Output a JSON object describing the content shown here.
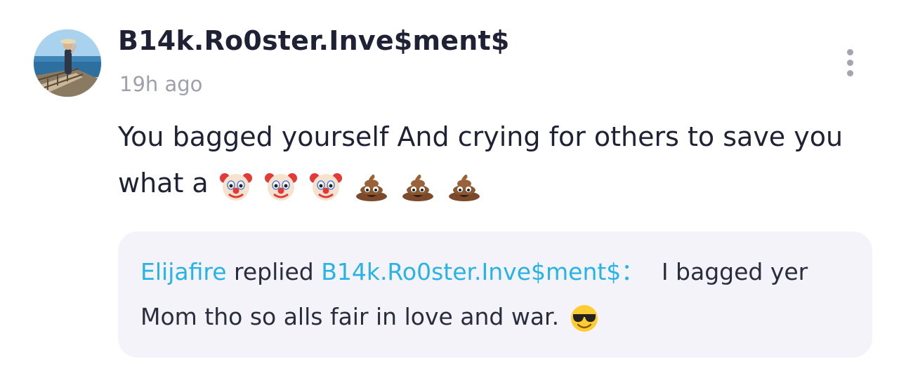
{
  "comment": {
    "author": "B14k.Ro0ster.Inve$ment$",
    "time": "19h ago",
    "text": "You bagged yourself And crying for others to save you what a",
    "emojis": [
      "clown-face",
      "clown-face",
      "clown-face",
      "pile-of-poo",
      "pile-of-poo",
      "pile-of-poo"
    ],
    "more_icon": "vertical-ellipsis-icon"
  },
  "reply": {
    "author": "Elijafire",
    "action": "replied",
    "target": "B14k.Ro0ster.Inve$ment$",
    "colon": "：",
    "text": "I bagged yer Mom tho so alls fair in love and war.",
    "emoji": "smiling-face-with-sunglasses"
  },
  "colors": {
    "link": "#27b3e6",
    "text": "#1f2234",
    "muted": "#9ea1ab",
    "reply_bg": "#f3f3f9"
  }
}
